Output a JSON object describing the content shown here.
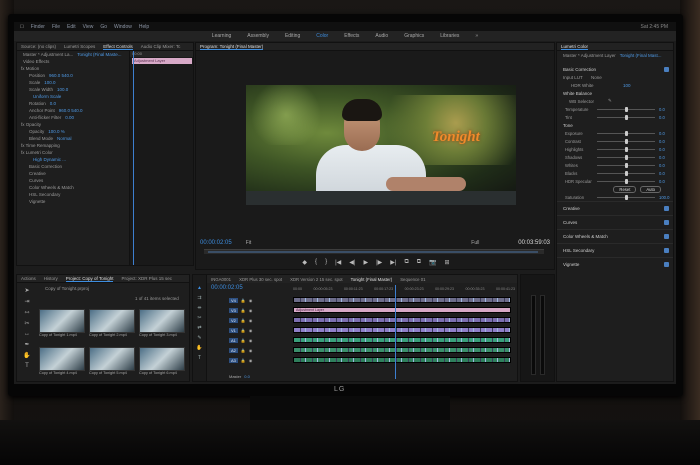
{
  "menubar": {
    "apple": "",
    "items": [
      "Finder",
      "File",
      "Edit",
      "View",
      "Go",
      "Window",
      "Help"
    ],
    "right": "Sat 2:45 PM"
  },
  "workspaces": {
    "items": [
      "Learning",
      "Assembly",
      "Editing",
      "Color",
      "Effects",
      "Audio",
      "Graphics",
      "Libraries"
    ],
    "active": "Color",
    "more": "»"
  },
  "effect_controls": {
    "tabs": [
      "Source: (no clips)",
      "Lumetri Scopes",
      "Effect Controls",
      "Audio Clip Mixer: Tc"
    ],
    "header": "Master * Adjustment La...",
    "header_seq": "Tonight (Final Maste...",
    "section": "Video Effects",
    "rows": [
      {
        "label": "fx  Motion",
        "value": ""
      },
      {
        "label": "Position",
        "value": "960.0   540.0"
      },
      {
        "label": "Scale",
        "value": "100.0"
      },
      {
        "label": "Scale Width",
        "value": "100.0"
      },
      {
        "label": "",
        "value": "Uniform Scale"
      },
      {
        "label": "Rotation",
        "value": "0.0"
      },
      {
        "label": "Anchor Point",
        "value": "960.0   540.0"
      },
      {
        "label": "Anti-flicker Filter",
        "value": "0.00"
      },
      {
        "label": "fx  Opacity",
        "value": ""
      },
      {
        "label": "Opacity",
        "value": "100.0 %"
      },
      {
        "label": "Blend Mode",
        "value": "Normal"
      },
      {
        "label": "fx  Time Remapping",
        "value": ""
      },
      {
        "label": "fx  Lumetri Color",
        "value": ""
      },
      {
        "label": "",
        "value": "High Dynamic ..."
      },
      {
        "label": "Basic Correction",
        "value": ""
      },
      {
        "label": "Creative",
        "value": ""
      },
      {
        "label": "Curves",
        "value": ""
      },
      {
        "label": "Color Wheels & Match",
        "value": ""
      },
      {
        "label": "HSL Secondary",
        "value": ""
      },
      {
        "label": "Vignette",
        "value": ""
      }
    ],
    "timeline_tc": "00:00",
    "clip_label": "Adjustment Layer"
  },
  "program": {
    "title": "Program: Tonight (Final Master)",
    "overlay_title": "Tonight",
    "timecode": "00:00:02:05",
    "fit": "Fit",
    "quality": "Full",
    "duration": "00:03:59:03",
    "controls": [
      "◆",
      "{",
      "}",
      "|◀",
      "◀|",
      "▶",
      "|▶",
      "▶|",
      "⧉",
      "⧉",
      "📷",
      "⊞"
    ]
  },
  "lumetri": {
    "title": "Lumetri Color",
    "header": "Master * Adjustment Layer",
    "header_seq": "Tonight (Final Mast...",
    "basic_correction": "Basic Correction",
    "input_lut_label": "Input LUT",
    "input_lut_value": "None",
    "hdr_white": "HDR White",
    "hdr_white_value": "100",
    "white_balance": "White Balance",
    "wb_selector": "WB Selector",
    "tone": "Tone",
    "sliders_wb": [
      {
        "label": "Temperature",
        "value": "0.0",
        "pos": 0.5
      },
      {
        "label": "Tint",
        "value": "0.0",
        "pos": 0.5
      }
    ],
    "sliders_tone": [
      {
        "label": "Exposure",
        "value": "0.0",
        "pos": 0.5
      },
      {
        "label": "Contrast",
        "value": "0.0",
        "pos": 0.5
      },
      {
        "label": "Highlights",
        "value": "0.0",
        "pos": 0.5
      },
      {
        "label": "Shadows",
        "value": "0.0",
        "pos": 0.5
      },
      {
        "label": "Whites",
        "value": "0.0",
        "pos": 0.5
      },
      {
        "label": "Blacks",
        "value": "0.0",
        "pos": 0.5
      },
      {
        "label": "HDR Specular",
        "value": "0.0",
        "pos": 0.5
      }
    ],
    "reset": "Reset",
    "auto": "Auto",
    "saturation_label": "Saturation",
    "saturation_value": "100.0",
    "saturation_pos": 0.5,
    "sections": [
      "Creative",
      "Curves",
      "Color Wheels & Match",
      "HSL Secondary",
      "Vignette"
    ]
  },
  "project": {
    "tabs": [
      "Actions",
      "History",
      "Project: Copy of Tonight",
      "Project: XDR Plus 15 sec"
    ],
    "file": "Copy of Tonight.prproj",
    "count": "1 of 41 items selected",
    "thumbnails": [
      "Copy of Tonight 1.mp4",
      "Copy of Tonight 2.mp4",
      "Copy of Tonight 3.mp4",
      "Copy of Tonight 4.mp4",
      "Copy of Tonight 5.mp4",
      "Copy of Tonight 6.mp4"
    ]
  },
  "timeline": {
    "tabs": [
      "INGA0001",
      "XDR Plus 30 sec. spot",
      "XDR Version 2 15 sec. spot",
      "Tonight (Final Master)",
      "Sequence 01"
    ],
    "active_tab": "Tonight (Final Master)",
    "timecode": "00:00:02:05",
    "ruler": [
      "00:00",
      "00:00:05:23",
      "00:00:11:23",
      "00:00:17:23",
      "00:00:23:23",
      "00:00:29:23",
      "00:00:35:23",
      "00:00:41:23"
    ],
    "tracks": [
      "V4",
      "V3",
      "V2",
      "V1",
      "A1",
      "A2",
      "A3"
    ],
    "master": "Master",
    "master_value": "0.0",
    "adjustment_clip": "Adjustment Layer"
  }
}
